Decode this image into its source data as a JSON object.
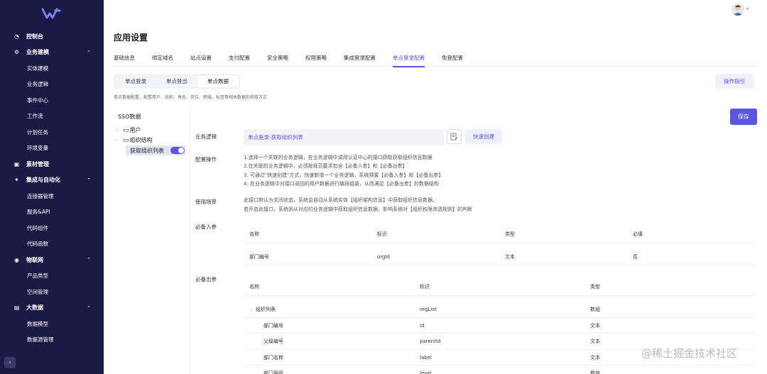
{
  "sidebar": {
    "groups": [
      {
        "label": "控制台",
        "icon": "dashboard-icon",
        "items": []
      },
      {
        "label": "业务建模",
        "icon": "gear-icon",
        "expanded": true,
        "items": [
          "实体建模",
          "业务逻辑",
          "事件中心",
          "工作流",
          "计划任务",
          "环境变量"
        ]
      },
      {
        "label": "素材管理",
        "icon": "image-icon",
        "items": []
      },
      {
        "label": "集成与自动化",
        "icon": "integration-icon",
        "expanded": true,
        "items": [
          "连接器管理",
          "服务&API",
          "代码组件",
          "代码函数"
        ]
      },
      {
        "label": "物联网",
        "icon": "iot-icon",
        "expanded": true,
        "items": [
          "产品类型",
          "空间管理"
        ]
      },
      {
        "label": "大数据",
        "icon": "bigdata-icon",
        "expanded": true,
        "items": [
          "数据模型",
          "数据源管理"
        ]
      }
    ]
  },
  "page_title": "应用设置",
  "tabs": [
    "基础信息",
    "绑定域名",
    "站点设置",
    "支付配置",
    "安全策略",
    "权限策略",
    "集成登录配置",
    "单点登录配置",
    "免登配置"
  ],
  "active_tab": "单点登录配置",
  "subtabs": [
    "单点登录",
    "单点登出",
    "单点数据"
  ],
  "active_subtab": "单点数据",
  "guide_label": "操作指引",
  "description": "单点数据配置，配置用户、组织、角色、岗位、职级、标签等相关数据的获取方式",
  "tree": {
    "title": "SSO数据",
    "nodes": [
      "用户",
      "组织结构"
    ],
    "selected": "获取组织列表"
  },
  "save_label": "保存",
  "form": {
    "logic_label": "业务逻辑",
    "logic_value": "单点登录-获取组织列表",
    "quick_create_label": "快速创建",
    "config_label": "配置操作",
    "steps": [
      "1.选择一个关联的业务逻辑，在业务逻辑中调用认证中心的接口获取获取组织信息数据",
      "2.在关联的业务逻辑中，必须按规范要求包含【必备入参】和【必备出参】",
      "3. 可通过\"快速创建\"方式，快速新增一个业务逻辑，系统预置【必备入参】和【必备出参】",
      "4. 在业务逻辑中对接口返回的用户数据进行编排组装，从而满足【必备出参】的数据结构"
    ],
    "scene_label": "使用场景",
    "scene_lines": [
      "此接口默认为关闭状态，系统会自动从系统实体【组织架构信息】中获取组织信息数据。",
      "若开启此接口，系统则从对应的业务逻辑中获取组织信息数据，影响系统对【组织权限渗透规则】的判断"
    ],
    "input_label": "必备入参",
    "input_table": {
      "headers": [
        "名称",
        "标识",
        "类型",
        "必填"
      ],
      "rows": [
        [
          "部门编号",
          "orgId",
          "文本",
          "否"
        ]
      ]
    },
    "output_label": "必备出参",
    "output_table": {
      "headers": [
        "名称",
        "标识",
        "类型"
      ],
      "rows": [
        [
          "组织列表",
          "orgList",
          "数组"
        ],
        [
          "部门编号",
          "id",
          "文本"
        ],
        [
          "父级编号",
          "parentId",
          "文本"
        ],
        [
          "部门名称",
          "label",
          "文本"
        ],
        [
          "部门层级",
          "level",
          "数值"
        ]
      ]
    }
  },
  "watermark": "@稀土掘金技术社区",
  "colors": {
    "sidebar": "#1b1a45",
    "accent": "#5b55e0"
  }
}
